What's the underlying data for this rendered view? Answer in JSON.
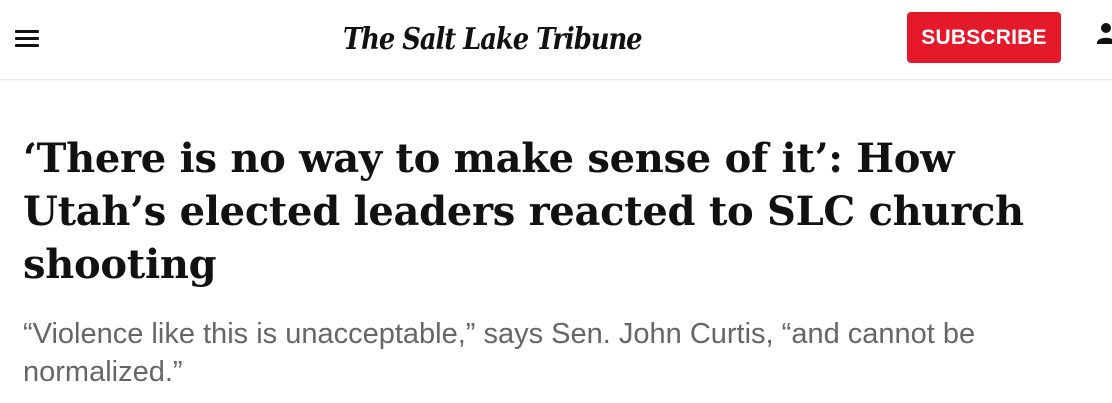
{
  "header": {
    "logo_text": "The Salt Lake Tribune",
    "subscribe_label": "SUBSCRIBE",
    "subscribe_color": "#e4192a"
  },
  "icons": {
    "menu": "hamburger-menu-icon",
    "account": "user-account-icon"
  },
  "article": {
    "headline": "‘There is no way to make sense of it’: How Utah’s elected leaders reacted to SLC church shooting",
    "dek": "“Violence like this is unacceptable,” says Sen. John Curtis, “and cannot be normalized.”"
  }
}
